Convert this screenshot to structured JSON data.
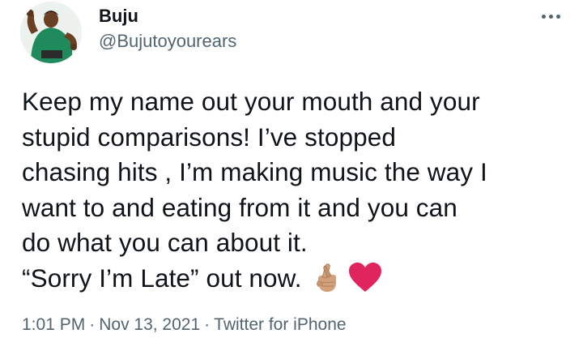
{
  "author": {
    "display_name": "Buju",
    "handle": "@Bujutoyourears",
    "avatar_icon": "profile-avatar"
  },
  "more_icon": "more-horizontal-icon",
  "tweet": {
    "lines": [
      "Keep my name out your mouth and your",
      "stupid comparisons! I’ve stopped",
      "chasing hits , I’m making music the way I",
      "want to and eating from it and you can",
      "do what you can about it."
    ],
    "last_line": "“Sorry I’m Late” out now.",
    "emojis": [
      "crossed-fingers-icon",
      "red-heart-icon"
    ]
  },
  "meta": {
    "time": "1:01 PM",
    "separator": "·",
    "date": "Nov 13, 2021",
    "source": "Twitter for iPhone"
  },
  "colors": {
    "text": "#0f1419",
    "secondary": "#536471",
    "heart": "#e0245e",
    "avatar_shirt": "#1f8a5b"
  }
}
